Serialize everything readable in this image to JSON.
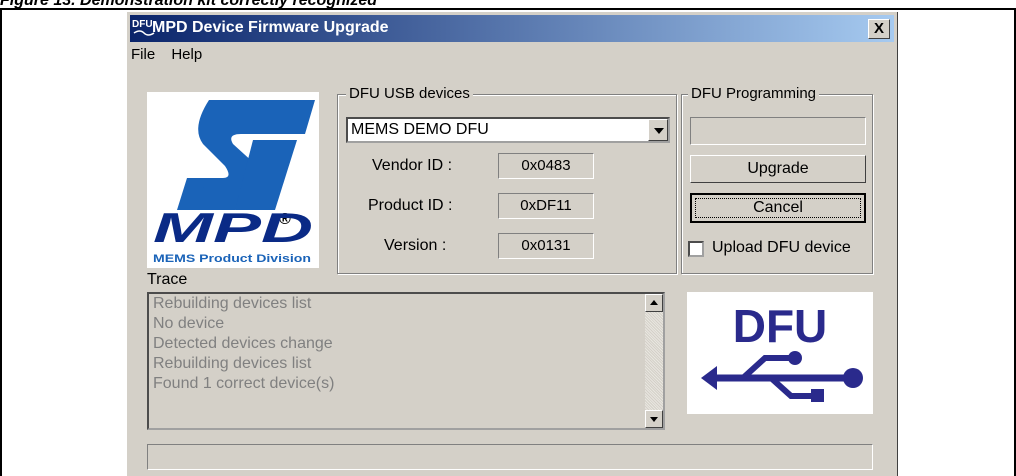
{
  "caption": "Figure 13.  Demonstration kit correctly recognized",
  "window": {
    "icon_text": "DFU",
    "title": "MPD Device Firmware Upgrade",
    "close_label": "X"
  },
  "menu": {
    "file": "File",
    "help": "Help"
  },
  "logo": {
    "st_text": "ST",
    "registered": "®",
    "mpd_text": "MPD",
    "division": "MEMS Product Division"
  },
  "usb_devices": {
    "label": "DFU USB devices",
    "selected": "MEMS DEMO DFU",
    "vendor_label": "Vendor ID :",
    "vendor_value": "0x0483",
    "product_label": "Product ID :",
    "product_value": "0xDF11",
    "version_label": "Version :",
    "version_value": "0x0131"
  },
  "programming": {
    "label": "DFU Programming",
    "upgrade_label": "Upgrade",
    "cancel_label": "Cancel",
    "upload_label": "Upload DFU device"
  },
  "trace": {
    "label": "Trace",
    "lines": [
      "Rebuilding devices list",
      "No device",
      "Detected devices change",
      "Rebuilding devices list",
      "Found 1 correct device(s)"
    ]
  },
  "dfu_logo": {
    "text": "DFU",
    "brand_color": "#2a2a8c"
  }
}
